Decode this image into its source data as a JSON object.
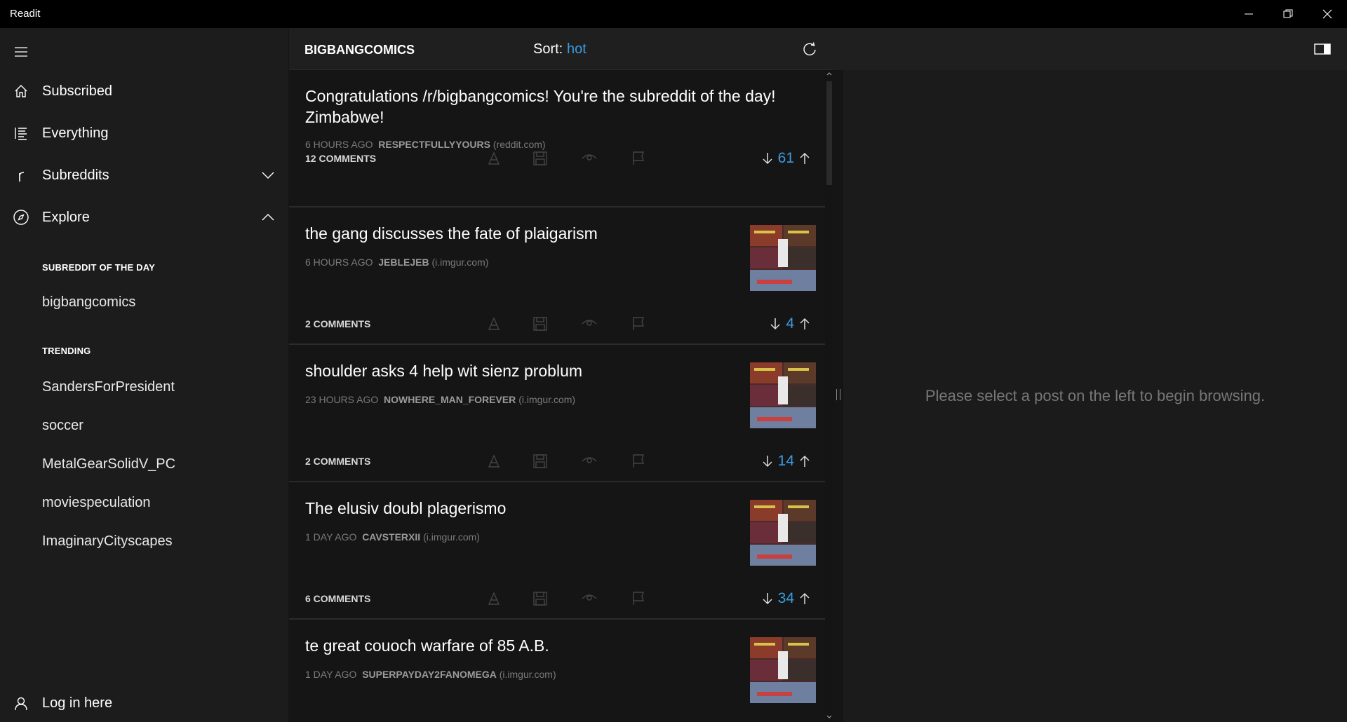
{
  "app": {
    "title": "Readit"
  },
  "sidebar": {
    "nav": [
      {
        "label": "Subscribed",
        "icon": "home-icon"
      },
      {
        "label": "Everything",
        "icon": "list-icon"
      },
      {
        "label": "Subreddits",
        "icon": "r-icon"
      },
      {
        "label": "Explore",
        "icon": "compass-icon"
      }
    ],
    "sotd_header": "SUBREDDIT OF THE DAY",
    "sotd": "bigbangcomics",
    "trending_header": "TRENDING",
    "trending": [
      "SandersForPresident",
      "soccer",
      "MetalGearSolidV_PC",
      "moviespeculation",
      "ImaginaryCityscapes"
    ],
    "login": "Log in here"
  },
  "header": {
    "subreddit": "BIGBANGCOMICS",
    "sort_label": "Sort:",
    "sort_value": "hot"
  },
  "posts": [
    {
      "title": "Congratulations /r/bigbangcomics! You're the subreddit of the day! Zimbabwe!",
      "age": "6 HOURS AGO",
      "author": "RESPECTFULLYYOURS",
      "domain": "(reddit.com)",
      "comments": "12 COMMENTS",
      "score": "61",
      "thumb": false
    },
    {
      "title": "the gang discusses the fate of plaigarism",
      "age": "6 HOURS AGO",
      "author": "JEBLEJEB",
      "domain": "(i.imgur.com)",
      "comments": "2 COMMENTS",
      "score": "4",
      "thumb": true
    },
    {
      "title": "shoulder asks 4 help wit sienz problum",
      "age": "23 HOURS AGO",
      "author": "NOWHERE_MAN_FOREVER",
      "domain": "(i.imgur.com)",
      "comments": "2 COMMENTS",
      "score": "14",
      "thumb": true
    },
    {
      "title": "The elusiv doubl plagerismo",
      "age": "1 DAY AGO",
      "author": "CAVSTERXII",
      "domain": "(i.imgur.com)",
      "comments": "6 COMMENTS",
      "score": "34",
      "thumb": true
    },
    {
      "title": "te great couoch warfare of 85 A.B.",
      "age": "1 DAY AGO",
      "author": "SUPERPAYDAY2FANOMEGA",
      "domain": "(i.imgur.com)",
      "comments": "",
      "score": "",
      "thumb": true
    }
  ],
  "detail": {
    "empty_message": "Please select a post on the left to begin browsing."
  },
  "colors": {
    "accent": "#3b9be0",
    "background": "#171717",
    "titlebar": "#000000"
  }
}
